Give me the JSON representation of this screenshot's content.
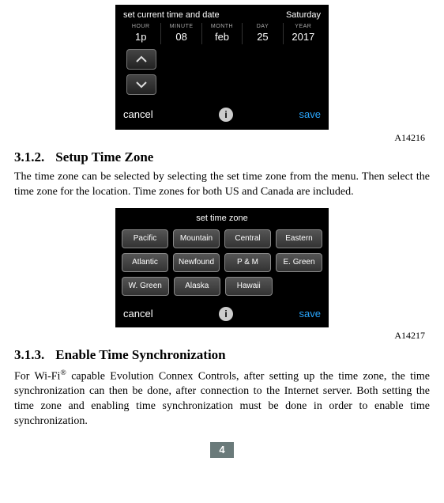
{
  "fig1": {
    "id": "A14216",
    "title": "set current time and date",
    "weekday": "Saturday",
    "cols": {
      "hour": {
        "lab": "HOUR",
        "val": "1p"
      },
      "minute": {
        "lab": "MINUTE",
        "val": "08"
      },
      "month": {
        "lab": "MONTH",
        "val": "feb"
      },
      "day": {
        "lab": "DAY",
        "val": "25"
      },
      "year": {
        "lab": "YEAR",
        "val": "2017"
      }
    },
    "cancel": "cancel",
    "save": "save",
    "info": "i"
  },
  "sec312": {
    "num": "3.1.2.",
    "title": "Setup Time Zone",
    "body": "The time zone can be selected by selecting the set time zone from the menu. Then select the time zone for the location. Time zones for both US and Canada are included."
  },
  "fig2": {
    "id": "A14217",
    "title": "set time zone",
    "rows": [
      [
        "Pacific",
        "Mountain",
        "Central",
        "Eastern"
      ],
      [
        "Atlantic",
        "Newfound",
        "P & M",
        "E. Green"
      ],
      [
        "W. Green",
        "Alaska",
        "Hawaii"
      ]
    ],
    "cancel": "cancel",
    "save": "save",
    "info": "i"
  },
  "sec313": {
    "num": "3.1.3.",
    "title": "Enable Time Synchronization",
    "body_pre": "For Wi-Fi",
    "body_post": " capable Evolution Connex Controls, after setting up the time zone, the time synchronization can then be done, after connection to the Internet server. Both setting the time zone and enabling time synchronization must be done in order to enable time synchronization.",
    "reg": "®"
  },
  "pagenum": "4"
}
